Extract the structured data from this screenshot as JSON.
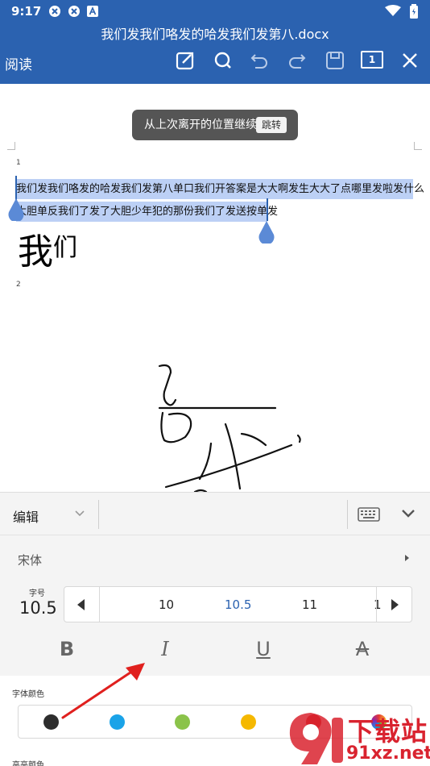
{
  "status": {
    "time": "9:17"
  },
  "header": {
    "title": "我们发我们咯发的哈发我们发第八.docx",
    "read_mode": "阅读",
    "page_number": "1"
  },
  "toast": {
    "text": "从上次离开的位置继续",
    "action": "跳转"
  },
  "doc": {
    "page1_label": "1",
    "page2_label": "2",
    "line1": "我们发我们咯发的哈发我们发第八单口我们开答案是大大啊发生大大了点哪里发啦发什么",
    "line2": "大胆单反我们了发了大胆少年犯的那份我们了发送按单发",
    "big_main": "我",
    "big_small": "们"
  },
  "panel": {
    "mode": "编辑",
    "font_name": "宋体",
    "size_label": "字号",
    "size_value": "10.5",
    "size_options": [
      "10",
      "10.5",
      "11",
      "1"
    ],
    "selected_size": "10.5",
    "format_bold": "B",
    "format_italic": "I",
    "format_underline": "U",
    "format_strike": "A",
    "font_color_label": "字体颜色",
    "highlight_label": "高亮颜色",
    "colors": [
      "#2d2d2d",
      "#1aa3e8",
      "#8bc34a",
      "#f5b800",
      "#cc1b1b"
    ]
  },
  "watermark": {
    "brand": "下载站",
    "url": "91xz.net"
  }
}
